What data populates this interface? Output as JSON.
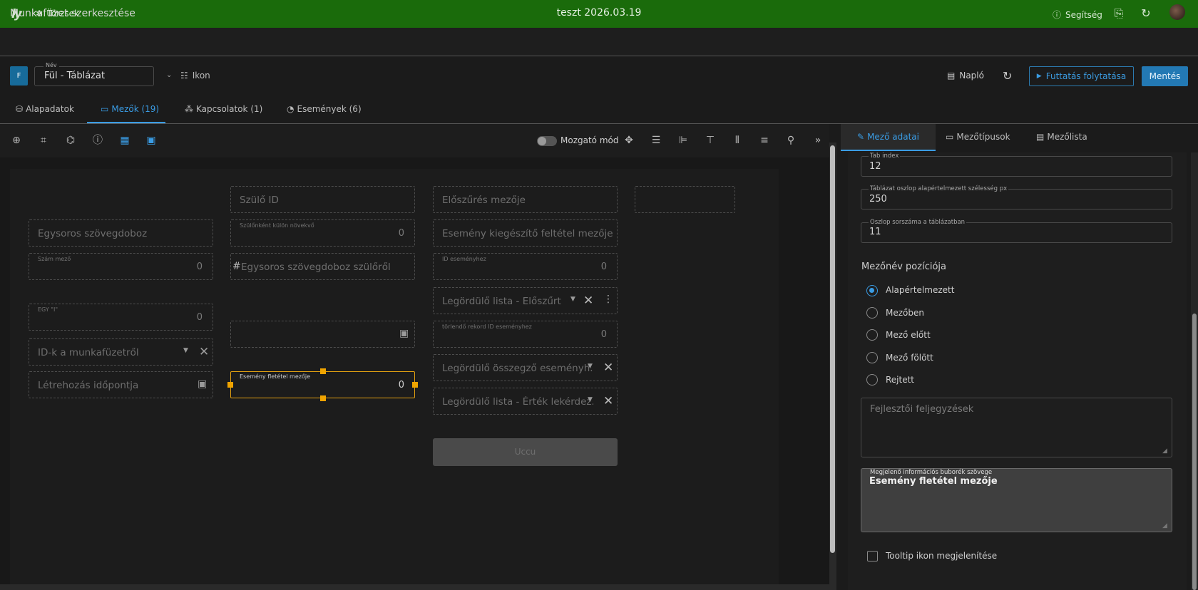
{
  "topbar": {
    "logo": "ly",
    "torzsek": "Törzsek",
    "title": "teszt 2026.03.19",
    "help": "Segítség"
  },
  "page": {
    "title": "Munkafüzet szerkesztése"
  },
  "name": {
    "badge": "F",
    "label": "Név",
    "value": "Fül - Táblázat",
    "icon_label": "Ikon"
  },
  "actions": {
    "log": "Napló",
    "run": "Futtatás folytatása",
    "save": "Mentés"
  },
  "tabs": [
    {
      "label": "Alapadatok"
    },
    {
      "label": "Mezők (19)"
    },
    {
      "label": "Kapcsolatok (1)"
    },
    {
      "label": "Események (6)"
    }
  ],
  "toolbar": {
    "move_mode": "Mozgató mód"
  },
  "fields": {
    "szulo_id": "Szülő ID",
    "elo_szures": "Előszűrés mezője",
    "egysoros": "Egysoros szövegdoboz",
    "szulonkent_label": "Szülőnként külön növekvő",
    "szulonkent_value": "0",
    "esemeny_kieg": "Esemény kiegészítő feltétel mezője",
    "szam_label": "Szám mező",
    "szam_value": "0",
    "egysoros_szulo": "Egysoros szövegdoboz szülőről",
    "id_esemeny_label": "ID eseményhez",
    "id_esemeny_value": "0",
    "legordulo_eloszurt": "Legördülő lista - Előszűrt",
    "egy_label": "EGY \"I\"",
    "egy_value": "0",
    "torlendo_label": "törlendő rekord ID eseményhez",
    "torlendo_value": "0",
    "id_munkafuzet": "ID-k a munkafüzetről",
    "esemeny_feltetel_label": "Esemény fletétel mezője",
    "esemeny_feltetel_value": "0",
    "legordulo_osszegzo": "Legördülő összegző eseményh...",
    "letrehozas": "Létrehozás időpontja",
    "legordulo_ertek": "Legördülő lista - Érték lekérdez...",
    "uccu": "Uccu"
  },
  "right": {
    "tabs": [
      {
        "label": "Mező adatai"
      },
      {
        "label": "Mezőtípusok"
      },
      {
        "label": "Mezőlista"
      }
    ],
    "tab_index_label": "Tab index",
    "tab_index_value": "12",
    "col_width_label": "Táblázat oszlop alapértelmezett szélesség px",
    "col_width_value": "250",
    "col_order_label": "Oszlop sorszáma a táblázatban",
    "col_order_value": "11",
    "position_heading": "Mezőnév pozíciója",
    "positions": [
      "Alapértelmezett",
      "Mezőben",
      "Mező előtt",
      "Mező fölött",
      "Rejtett"
    ],
    "selected_position": "Alapértelmezett",
    "notes_placeholder": "Fejlesztői feljegyzések",
    "tooltip_label": "Megjelenő információs buborék szövege",
    "tooltip_value": "Esemény fletétel mezője",
    "tooltip_icon_label": "Tooltip ikon megjelenítése"
  },
  "colors": {
    "topbar": "#1a6b0b",
    "accent": "#3a9ce4",
    "selection": "#f0a400"
  }
}
